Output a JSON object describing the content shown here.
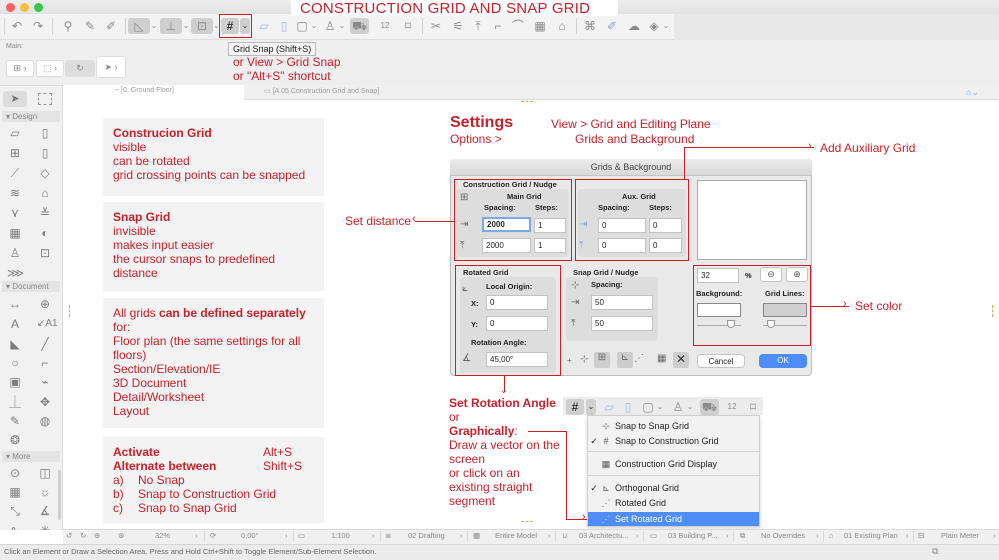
{
  "window": {
    "title": "CONSTRUCTION GRID AND SNAP GRID",
    "traffic_colors": [
      "#fc605c",
      "#fdbc40",
      "#34c84a"
    ]
  },
  "toolbar": {
    "icons": [
      "undo-icon",
      "redo-icon",
      "pick-up-parameters-icon",
      "eyedropper-icon",
      "syringe-icon",
      "guide-lines-icon",
      "tracker-icon",
      "magic-wand-icon",
      "grid-snap-icon",
      "grid-snap-dropdown",
      "editing-plane-icon",
      "parallel-plane-icon",
      "suspend-groups-icon",
      "layer-icon",
      "trace-reference-icon",
      "measure-icon",
      "fit-in-window-icon",
      "split-icon",
      "adjust-icon",
      "elevation-icon",
      "offset-icon",
      "fillet-icon",
      "curtain-wall-icon",
      "home-icon",
      "group-icon",
      "renovation-icon",
      "cloud-icon",
      "3d-view-icon"
    ],
    "tooltip": "Grid Snap (Shift+S)",
    "annotation_line1": "or View > Grid Snap",
    "annotation_line2": "or \"Alt+S\" shortcut"
  },
  "infobox": {
    "label": "Main:",
    "pills": [
      "geometry-method",
      "selection-method",
      "rotate",
      "arrow"
    ]
  },
  "tabs": [
    {
      "label": "[0. Ground Floor]",
      "icon": "floor-plan-icon",
      "active": true
    },
    {
      "label": "[A.05 Construction Grid and Snap]",
      "icon": "layout-icon",
      "active": false
    }
  ],
  "toolbox": {
    "sections": [
      {
        "label": "Design",
        "tools": [
          "wall-icon",
          "door-icon",
          "window-icon",
          "column-icon",
          "beam-icon",
          "slab-icon",
          "stair-icon",
          "roof-icon",
          "shell-icon",
          "railing-icon",
          "curtain-wall-icon",
          "morph-icon",
          "object-icon",
          "zone-icon",
          "mesh-icon"
        ]
      },
      {
        "label": "Document",
        "tools": [
          "dimension-icon",
          "level-dimension-icon",
          "text-icon",
          "label-icon",
          "fill-icon",
          "line-icon",
          "circle-icon",
          "polyline-icon",
          "drawing-icon",
          "section-icon",
          "elevation-icon",
          "interior-elevation-icon",
          "worksheet-icon",
          "detail-icon",
          "change-icon"
        ]
      },
      {
        "label": "More",
        "tools": [
          "grid-element-icon",
          "wall-end-icon",
          "skylight-icon",
          "lamp-icon",
          "radial-dimension-icon",
          "angle-dimension-icon",
          "spline-icon",
          "hotspot-icon"
        ]
      }
    ]
  },
  "notes": {
    "box1": {
      "title": "Construcion Grid",
      "lines": [
        "visible",
        "can be rotated",
        "grid crossing points can be snapped"
      ]
    },
    "box2": {
      "title": "Snap Grid",
      "lines": [
        "invisible",
        "makes input easier",
        "the cursor snaps to predefined",
        "distance"
      ]
    },
    "box3": {
      "prefix": "All grids ",
      "bold": "can be defined separately",
      "lines": [
        "for:",
        "Floor plan (the same settings for all",
        "floors)",
        "Section/Elevation/IE",
        "3D Document",
        "Detail/Worksheet",
        "Layout"
      ]
    },
    "box4": {
      "activate": "Activate",
      "activate_key": "Alt+S",
      "alternate": "Alternate between",
      "alternate_key": "Shift+S",
      "options": [
        {
          "letter": "a)",
          "text": "No Snap"
        },
        {
          "letter": "b)",
          "text": "Snap to Construction Grid"
        },
        {
          "letter": "c)",
          "text": "Snap to Snap Grid"
        }
      ]
    }
  },
  "settings": {
    "heading": "Settings",
    "sub": "Options >",
    "path1": "View > Grid and Editing Plane",
    "path2": "Grids and Background"
  },
  "annotations": {
    "add_aux": "Add Auxiliary Grid",
    "set_distance": "Set distance",
    "set_color": "Set color",
    "rotation_title": "Set Rotation Angle",
    "rotation_or": "or",
    "graphically": "Graphically",
    "graphically_colon": ":",
    "graphically_lines": [
      "Draw a vector on the",
      "screen",
      "or click on an",
      "existing straight",
      "segment"
    ]
  },
  "dialog": {
    "title": "Grids & Background",
    "construction": {
      "label": "Construction Grid / Nudge",
      "main_grid": "Main Grid",
      "spacing": "Spacing:",
      "steps": "Steps:",
      "x_spacing": "2000",
      "x_steps": "1",
      "y_spacing": "2000",
      "y_steps": "1"
    },
    "aux": {
      "label": "Aux. Grid",
      "spacing": "Spacing:",
      "steps": "Steps:",
      "x_spacing": "0",
      "x_steps": "0",
      "y_spacing": "0",
      "y_steps": "0"
    },
    "rotated": {
      "label": "Rotated Grid",
      "local_origin": "Local Origin:",
      "x_label": "X:",
      "x_value": "0",
      "y_label": "Y:",
      "y_value": "0",
      "angle_label": "Rotation Angle:",
      "angle_value": "45,00°"
    },
    "snap": {
      "label": "Snap Grid / Nudge",
      "spacing": "Spacing:",
      "x_value": "50",
      "y_value": "50"
    },
    "preview": {
      "zoom_value": "32",
      "zoom_unit": "%",
      "background_label": "Background:",
      "grid_lines_label": "Grid Lines:",
      "background_color": "#ffffff",
      "grid_lines_color": "#d0d0d0",
      "background_slider": 0.75,
      "grid_lines_slider": 0.1
    },
    "cancel": "Cancel",
    "ok": "OK",
    "ok_color": "#4d8df5"
  },
  "dropdown": {
    "items": [
      {
        "label": "Snap to Snap Grid",
        "checked": false,
        "icon": "snap-grid-icon"
      },
      {
        "label": "Snap to Construction Grid",
        "checked": true,
        "icon": "construction-grid-icon"
      },
      {
        "separator": true
      },
      {
        "label": "Construction Grid Display",
        "checked": false,
        "icon": "grid-display-icon"
      },
      {
        "separator": true
      },
      {
        "label": "Orthogonal Grid",
        "checked": true,
        "icon": "orthogonal-grid-icon"
      },
      {
        "label": "Rotated Grid",
        "checked": false,
        "icon": "rotated-grid-icon"
      },
      {
        "label": "Set Rotated Grid",
        "checked": false,
        "icon": "set-rotated-grid-icon",
        "selected": true
      }
    ]
  },
  "statusbar": {
    "zoom": "32%",
    "angle": "0,00°",
    "scale": "1:100",
    "layer_combo": "02 Drafting",
    "model_view": "Entire Model",
    "pen_set": "03 Architectu...",
    "mvo": "03 Building P...",
    "graphic_override": "No Overrides",
    "renovation": "01 Existing Plan",
    "dimension": "Plain Meter"
  },
  "hint": "Click an Element or Draw a Selection Area. Press and Hold Ctrl+Shift to Toggle Element/Sub-Element Selection."
}
